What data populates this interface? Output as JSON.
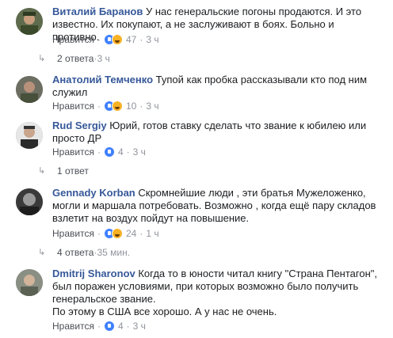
{
  "comments": [
    {
      "author": "Виталий Баранов",
      "text": " У нас генеральские погоны продаются. И это известно. Их покупают, а не заслуживают в боях. Больно и противно.",
      "like": "Нравится",
      "reactions": "47",
      "time": "3 ч",
      "replies": "2 ответа",
      "replies_time": "3 ч"
    },
    {
      "author": "Анатолий Темченко",
      "text": " Тупой как пробка рассказывали кто под ним служил",
      "like": "Нравится",
      "reactions": "10",
      "time": "3 ч"
    },
    {
      "author": "Rud Sergiy",
      "text": " Юрий, готов ставку сделать что звание к юбилею или просто ДР",
      "like": "Нравится",
      "reactions": "4",
      "time": "3 ч",
      "replies": "1 ответ",
      "replies_time": ""
    },
    {
      "author": "Gennady Korban",
      "text": " Скромнейшие люди , эти братья Мужеложенко, могли и маршала потребовать. Возможно , когда ещё пару складов взлетит на воздух пойдут на повышение.",
      "like": "Нравится",
      "reactions": "24",
      "time": "1 ч",
      "replies": "4 ответа",
      "replies_time": "35 мин."
    },
    {
      "author": "Dmitrij Sharonov",
      "text": " Когда то в юности читал книгу \"Страна Пентагон\", был поражен условиями, при которых возможно было получить генеральское звание.",
      "text2": "По этому в США все хорошо. А у нас не очень.",
      "like": "Нравится",
      "reactions": "4",
      "time": "3 ч"
    }
  ],
  "separator": "·",
  "reply_arrow": "↳",
  "colors": {
    "link": "#365899",
    "meta": "#90949c",
    "like_blue": "#4080ff",
    "haha_yellow": "#f7b125"
  },
  "icons": [
    "like-reaction-icon",
    "haha-reaction-icon",
    "reply-arrow-icon"
  ]
}
